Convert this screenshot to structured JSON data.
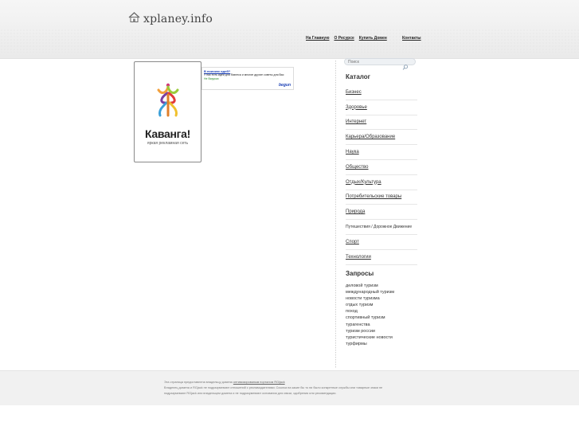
{
  "site": {
    "logo_text": "xplaney.info"
  },
  "nav": {
    "items": [
      "На Главную",
      "О Ресурсе",
      "Купить Домен"
    ],
    "contact": "Контакты"
  },
  "search": {
    "placeholder": "Поиск"
  },
  "ad_banner": {
    "brand": "Каванга!",
    "tagline": "яркая рекламная сеть"
  },
  "text_ad": {
    "title": "В поисках идей?",
    "body": "У нас есть идеи для бизнеса и многие другие советы для Вас",
    "url": "Не Вирусах",
    "network": "begun"
  },
  "catalog": {
    "heading": "Каталог",
    "items": [
      "Бизнес",
      "Здоровье",
      "Интернет",
      "Карьера/Образование",
      "Наука",
      "Общество",
      "Отдых/Культура",
      "Потребительские товары",
      "Природа",
      "Путешествия / Дорожное Движение",
      "Спорт",
      "Технологии"
    ]
  },
  "queries": {
    "heading": "Запросы",
    "items": [
      "деловой туризм",
      "международный туризм",
      "новости туризма",
      "отдых туризм",
      "поход",
      "спортивный туризм",
      "турагенства",
      "туризм россии",
      "туристические новости",
      "турфирмы"
    ]
  },
  "footer": {
    "line1_prefix": "Эта страница предоставлена владельцу домена",
    "line1_link": "оптимизированым порталом RGijack",
    "line2": "Владелец домена и RGjack не подразумевают отношений с рекламодателями. Ссылка на какие бы то ни было конкретные службы или товарные знаки не",
    "line3": "подразумевают RGjack или владельцем домена и не подразумевают основания для связи, одобрения или рекомендации."
  }
}
